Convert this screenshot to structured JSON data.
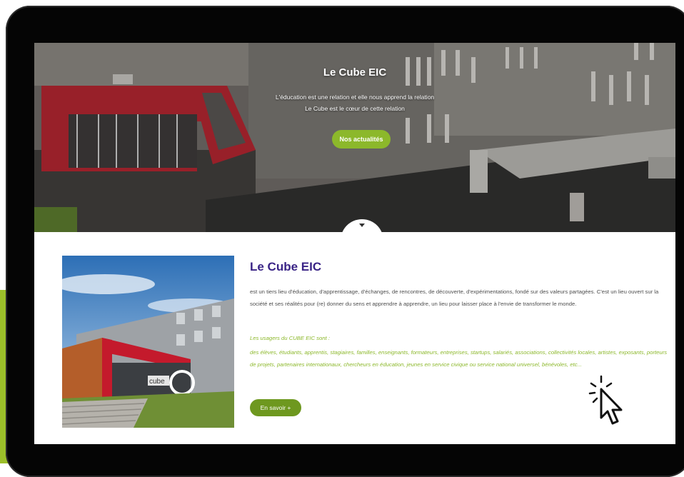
{
  "hero": {
    "title": "Le Cube EIC",
    "subtitle_line1": "L'éducation est une relation et elle nous apprend la relation",
    "subtitle_line2": "Le Cube est le cœur de cette relation",
    "button_label": "Nos actualités"
  },
  "content": {
    "title": "Le Cube EIC",
    "description": "est un tiers lieu d'éducation, d'apprentissage, d'échanges, de rencontres, de découverte, d'expérimentations, fondé sur des valeurs partagées. C'est un lieu ouvert sur la société et ses réalités pour (re) donner du sens et apprendre à apprendre, un lieu pour laisser place à l'envie de transformer le monde.",
    "users_heading": "Les usagers du CUBE EIC sont :",
    "users_list": "des élèves, étudiants, apprentis, stagiaires, familles, enseignants, formateurs, entreprises, startups, salariés, associations, collectivités locales, artistes, exposants, porteurs de projets, partenaires internationaux, chercheurs en éducation, jeunes en service civique ou service national universel, bénévoles, etc...",
    "button_label": "En savoir +"
  },
  "photo": {
    "sign_text": "cube"
  },
  "colors": {
    "accent_green": "#8cb82b",
    "button_dark_green": "#6e981f",
    "title_purple": "#3a2486",
    "brand_red": "#c41a2c",
    "device_frame": "#050505"
  },
  "icons": {
    "scroll": "chevron-down-icon",
    "cursor": "click-cursor-icon"
  }
}
